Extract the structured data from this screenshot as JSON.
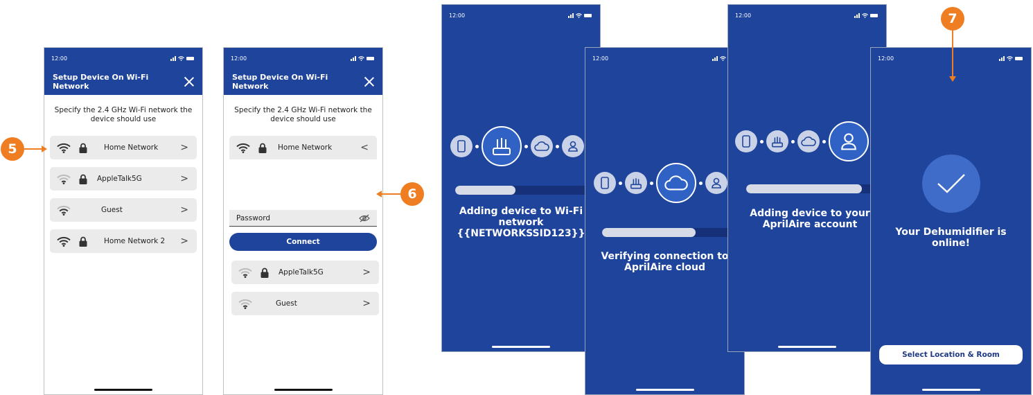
{
  "status_time": "12:00",
  "screen1": {
    "title": "Setup Device On Wi-Fi Network",
    "prompt": "Specify the 2.4 GHz Wi-Fi network the device should use",
    "networks": [
      {
        "name": "Home Network",
        "secured": true,
        "signal": "strong",
        "chevron": ">"
      },
      {
        "name": "AppleTalk5G",
        "secured": true,
        "signal": "weak",
        "chevron": ">"
      },
      {
        "name": "Guest",
        "secured": false,
        "signal": "weak",
        "chevron": ">"
      },
      {
        "name": "Home Network 2",
        "secured": true,
        "signal": "strong",
        "chevron": ">"
      }
    ]
  },
  "screen2": {
    "title": "Setup Device On Wi-Fi Network",
    "prompt": "Specify the 2.4 GHz Wi-Fi network the device should use",
    "selected_network": "Home Network",
    "selected_chevron": "<",
    "password_placeholder": "Password",
    "connect_label": "Connect",
    "networks": [
      {
        "name": "AppleTalk5G",
        "secured": true,
        "signal": "weak",
        "chevron": ">"
      },
      {
        "name": "Guest",
        "secured": false,
        "signal": "weak",
        "chevron": ">"
      }
    ]
  },
  "progress_screens": [
    {
      "status": "Adding device to Wi-Fi network {{NETWORKSSID123}}",
      "progress": 0.41,
      "active_step": "router"
    },
    {
      "status": "Verifying connection to AprilAire cloud",
      "progress": 0.65,
      "active_step": "cloud"
    },
    {
      "status": "Adding device to your AprilAire account",
      "progress": 0.82,
      "active_step": "account"
    }
  ],
  "final_screen": {
    "message": "Your Dehumidifier is online!",
    "button_label": "Select Location & Room"
  },
  "callouts": [
    "5",
    "6",
    "7"
  ],
  "colors": {
    "brand_blue": "#1f449c",
    "callout_orange": "#ef7d22",
    "row_gray": "#ebebeb"
  },
  "icons": [
    "wifi-icon",
    "lock-icon",
    "chevron-icon",
    "eye-off-icon",
    "phone-icon",
    "router-icon",
    "cloud-icon",
    "user-icon",
    "checkmark-icon",
    "close-icon"
  ]
}
